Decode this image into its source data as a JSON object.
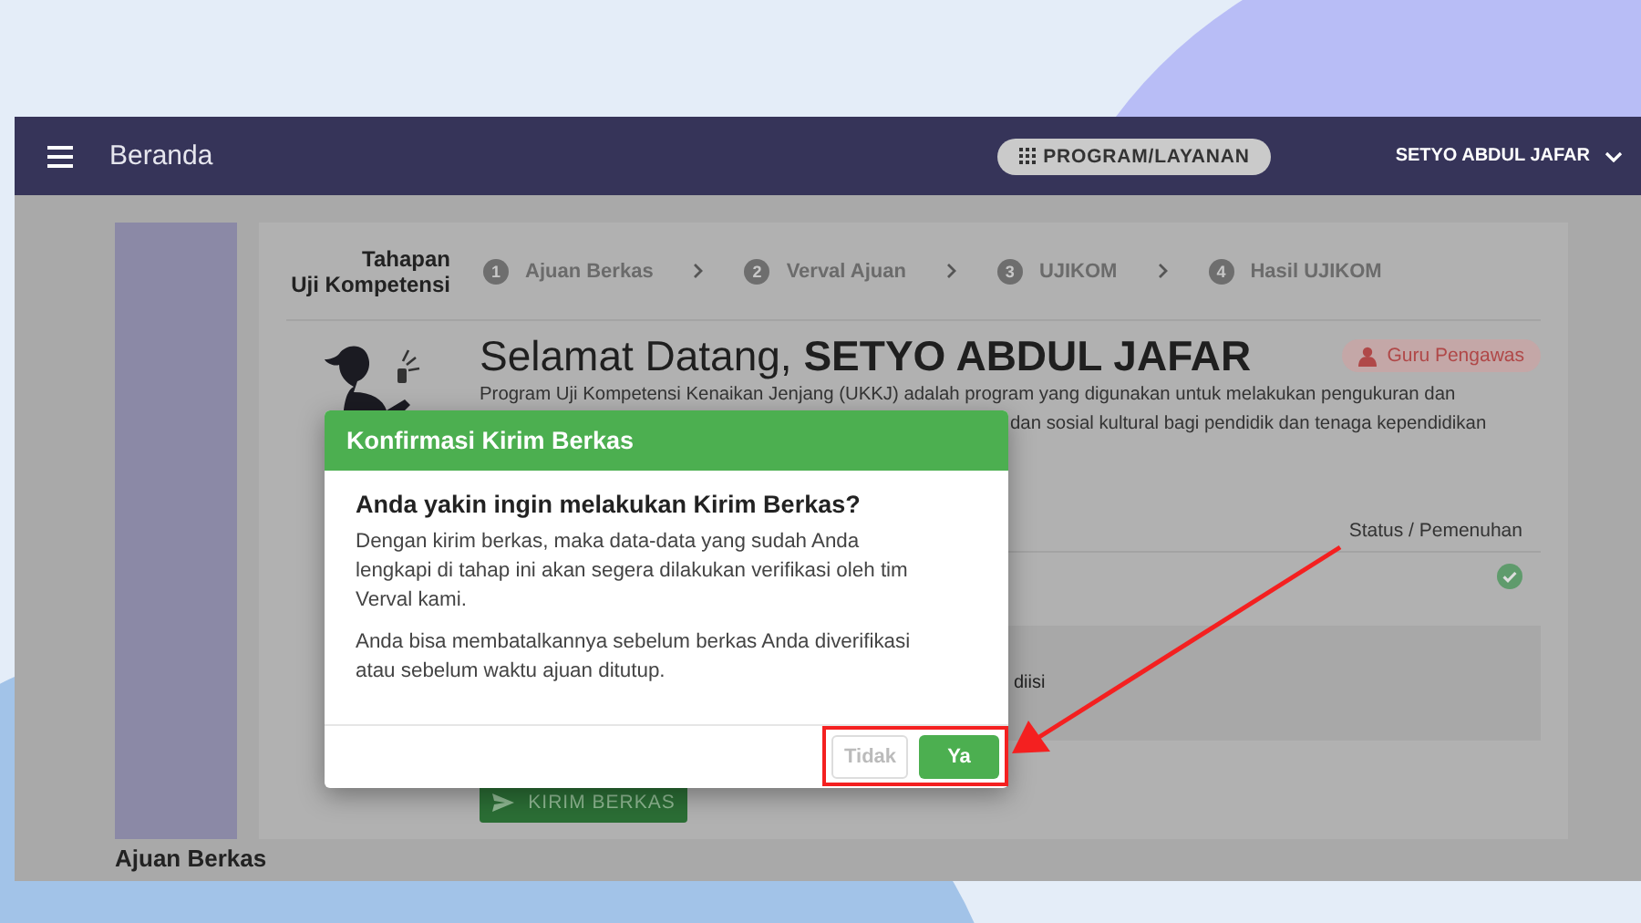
{
  "header": {
    "title": "Beranda",
    "program_button": "PROGRAM/LAYANAN",
    "user": "SETYO ABDUL JAFAR"
  },
  "stepper": {
    "title_lines": [
      "Tahapan",
      "Uji Kompetensi"
    ],
    "steps": [
      {
        "number": "1",
        "label": "Ajuan Berkas"
      },
      {
        "number": "2",
        "label": "Verval Ajuan"
      },
      {
        "number": "3",
        "label": "UJIKOM"
      },
      {
        "number": "4",
        "label": "Hasil UJIKOM"
      }
    ]
  },
  "welcome": {
    "greeting": "Selamat Datang, **SETYO ABDUL JAFAR**",
    "badge": "Guru Pengawas",
    "description_lines": [
      "Program Uji Kompetensi Kenaikan Jenjang (UKKJ) adalah program yang digunakan untuk melakukan pengukuran dan",
      "dan sosial kultural bagi pendidik dan tenaga kependidikan"
    ]
  },
  "status_table": {
    "column": "Status / Pemenuhan",
    "rows": [
      {
        "fulfilled": true
      }
    ]
  },
  "note": "diisi",
  "submit_button": "KIRIM BERKAS",
  "section_title": "Ajuan Berkas",
  "dialog": {
    "title": "Konfirmasi Kirim Berkas",
    "question": "Anda yakin ingin melakukan Kirim Berkas?",
    "paragraphs": [
      "Dengan kirim berkas, maka data-data yang sudah Anda lengkapi di tahap ini akan segera dilakukan verifikasi oleh tim Verval kami.",
      "Anda bisa membatalkannya sebelum berkas Anda diverifikasi atau sebelum waktu ajuan ditutup."
    ],
    "buttons": [
      {
        "label": "Tidak",
        "kind": "secondary"
      },
      {
        "label": "Ya",
        "kind": "primary"
      }
    ]
  }
}
